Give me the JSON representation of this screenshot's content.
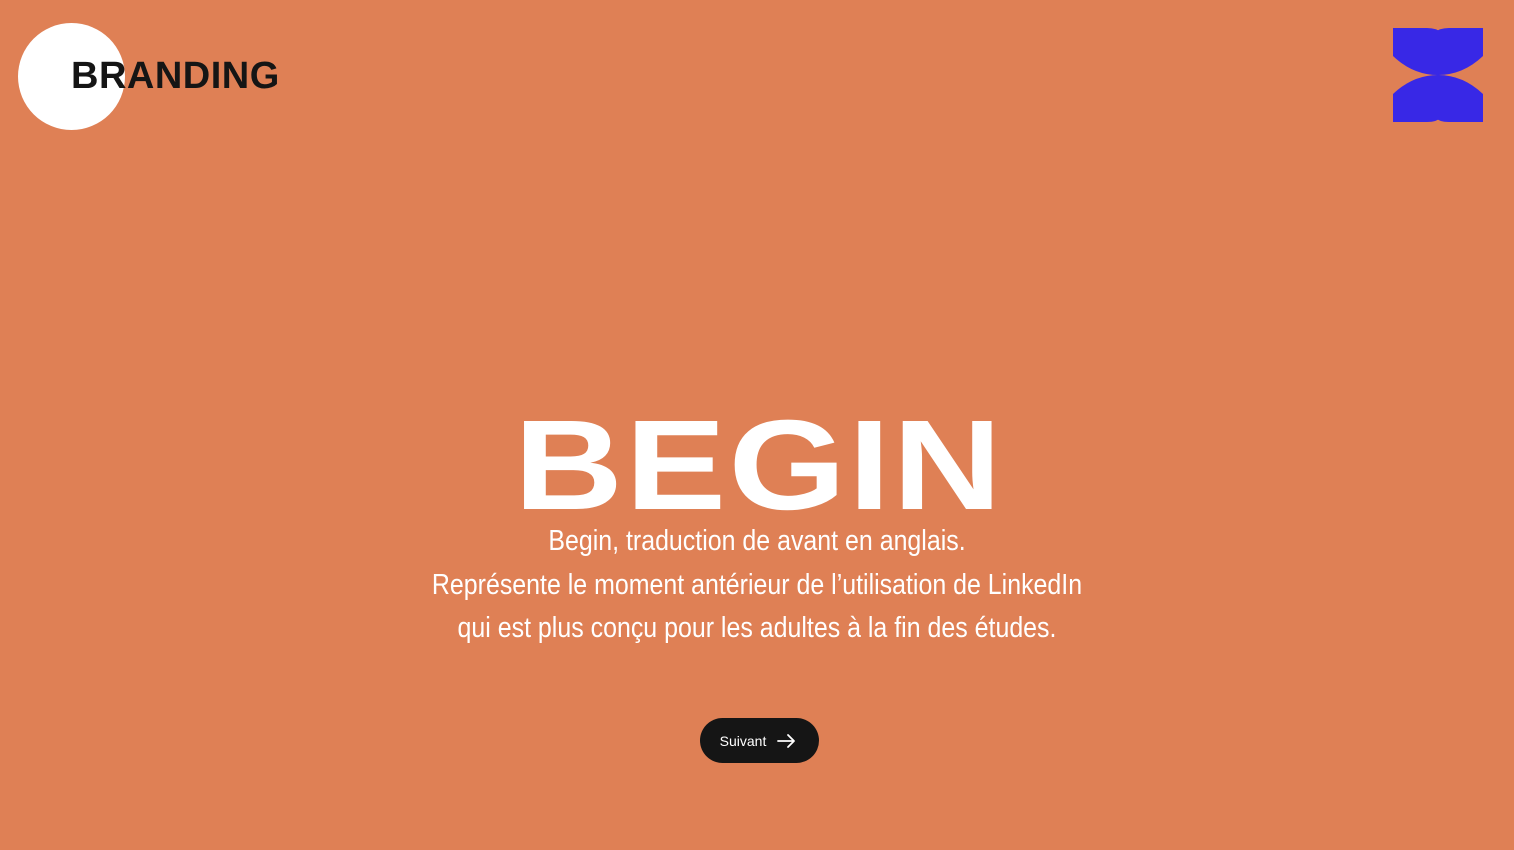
{
  "brand": {
    "logo_text": "BRANDING",
    "flower_color": "#3828E6"
  },
  "hero": {
    "title": "BEGIN",
    "description_lines": [
      "Begin, traduction de avant en anglais.",
      "Représente le moment antérieur de l’utilisation de LinkedIn",
      "qui est plus conçu pour les adultes à la fin des études."
    ]
  },
  "navigation": {
    "next_label": "Suivant",
    "next_icon": "arrow-right-icon"
  },
  "colors": {
    "background": "#DF8055",
    "text_light": "#FFFFFF",
    "text_dark": "#151515",
    "button": "#151515"
  }
}
